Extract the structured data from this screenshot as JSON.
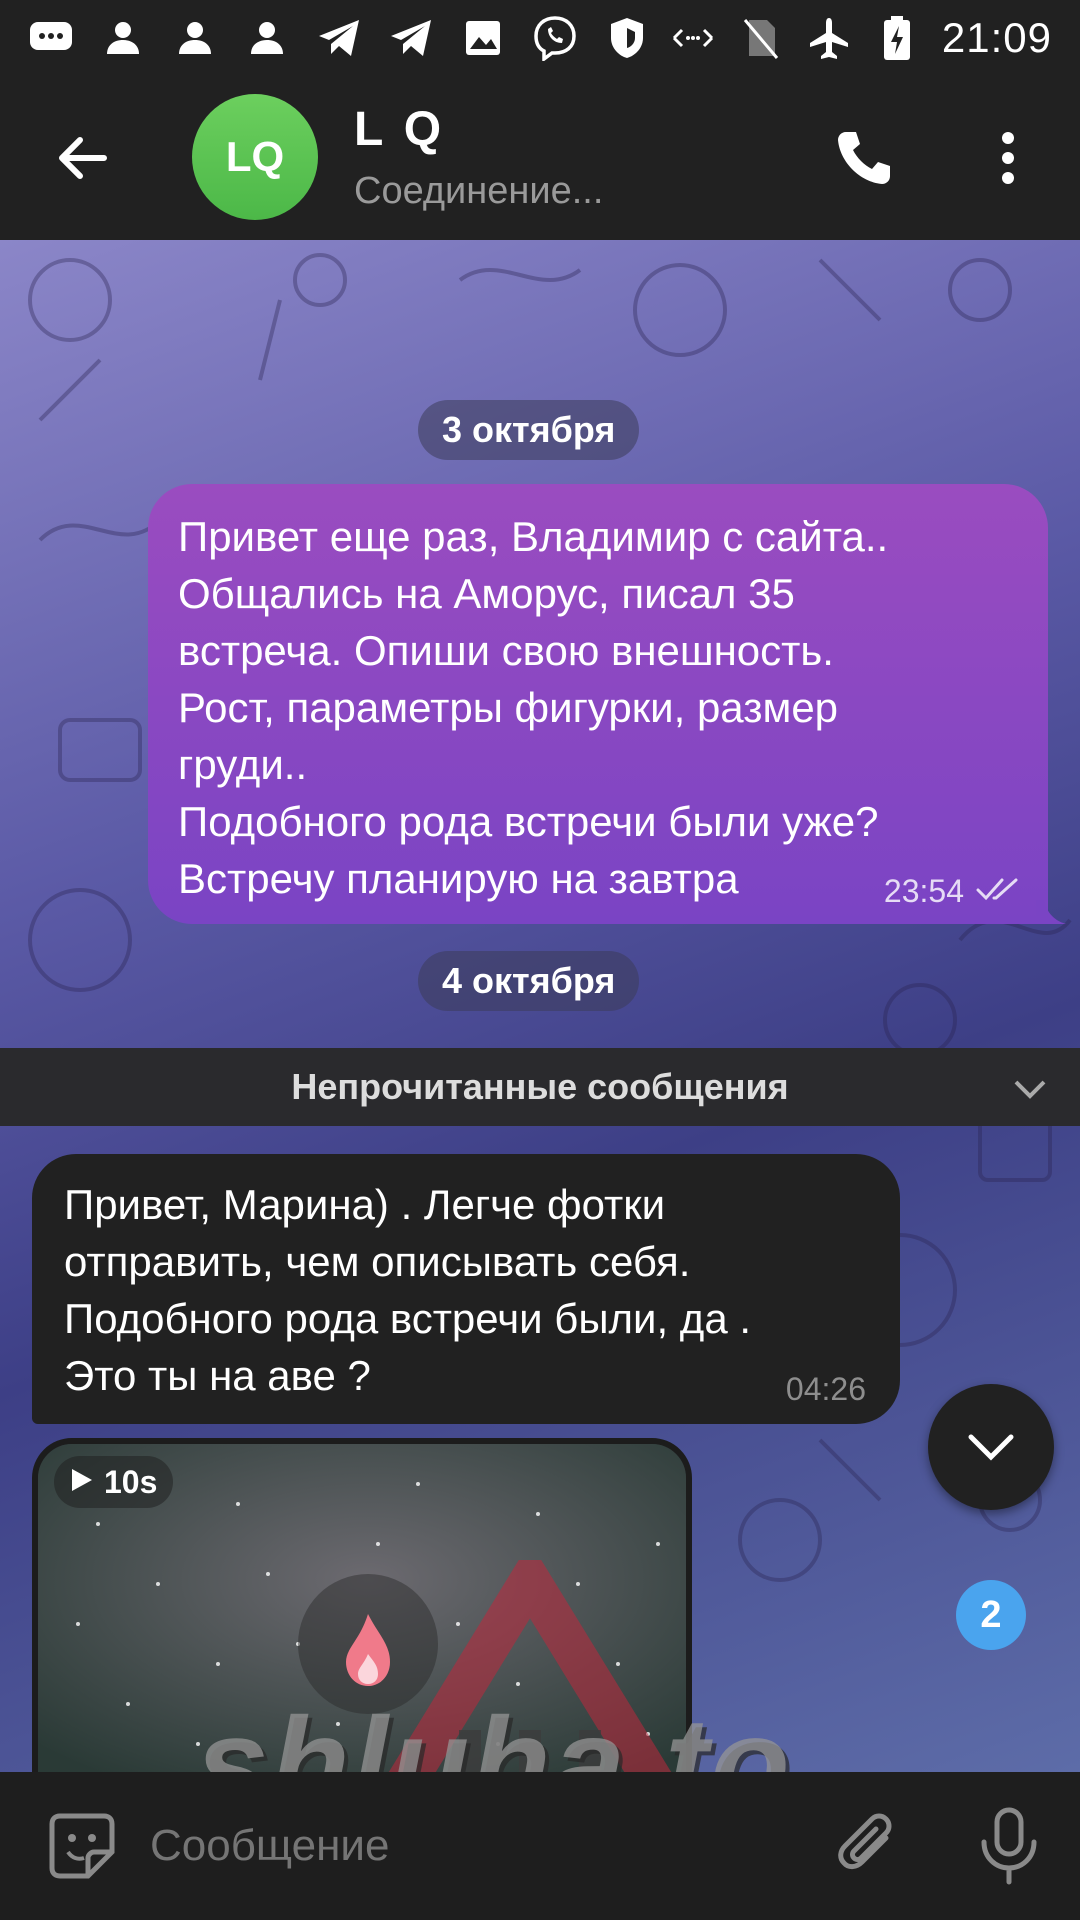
{
  "statusbar": {
    "time": "21:09",
    "left_icons": [
      "message-icon",
      "person-icon",
      "person-icon",
      "person-icon",
      "telegram-icon",
      "telegram-icon",
      "image-icon",
      "viber-icon",
      "shield-icon"
    ],
    "right_icons": [
      "data-arrows-icon",
      "no-sim-icon",
      "airplane-icon",
      "battery-charging-icon"
    ]
  },
  "header": {
    "avatar_initials": "LQ",
    "title": "L Q",
    "subtitle": "Соединение...",
    "avatar_color": "#55bf4b"
  },
  "chat": {
    "date1": "3 октября",
    "date2": "4 октября",
    "outgoing": {
      "text": "Привет еще раз, Владимир с сайта..\nОбщались на Аморус, писал 35\nвстреча. Опиши свою внешность.\nРост, параметры фигурки, размер\nгруди..\nПодобного рода встречи были уже?\nВстречу планирую на завтра",
      "time": "23:54",
      "status": "read",
      "color": "#8c48c2"
    },
    "unread_label": "Непрочитанные сообщения",
    "incoming": {
      "text": "Привет, Марина) . Легче фотки\nотправить, чем описывать себя.\nПодобного рода встречи были, да .\nЭто ты на аве ?",
      "time": "04:26"
    },
    "video": {
      "duration": "10s"
    },
    "scroll_badge": "2",
    "badge_color": "#4aa4ee"
  },
  "watermark": "shluha.to",
  "input": {
    "placeholder": "Сообщение"
  }
}
